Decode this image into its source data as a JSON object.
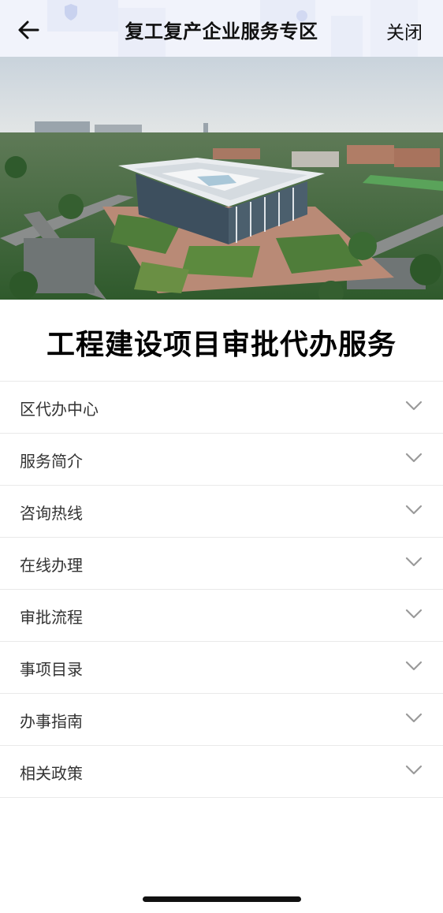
{
  "header": {
    "back_icon": "arrow-left-icon",
    "title": "复工复产企业服务专区",
    "close_label": "关闭"
  },
  "banner": {
    "image": "aerial-photo-government-building"
  },
  "main": {
    "title": "工程建设项目审批代办服务"
  },
  "menu": {
    "chevron_icon": "chevron-down-icon",
    "items": [
      {
        "label": "区代办中心"
      },
      {
        "label": "服务简介"
      },
      {
        "label": "咨询热线"
      },
      {
        "label": "在线办理"
      },
      {
        "label": "审批流程"
      },
      {
        "label": "事项目录"
      },
      {
        "label": "办事指南"
      },
      {
        "label": "相关政策"
      }
    ]
  },
  "colors": {
    "header_bg": "#eef1fb",
    "text": "#111111",
    "menu_text": "#333333",
    "divider": "#e9e9e9",
    "chevron": "#9a9a9a"
  }
}
